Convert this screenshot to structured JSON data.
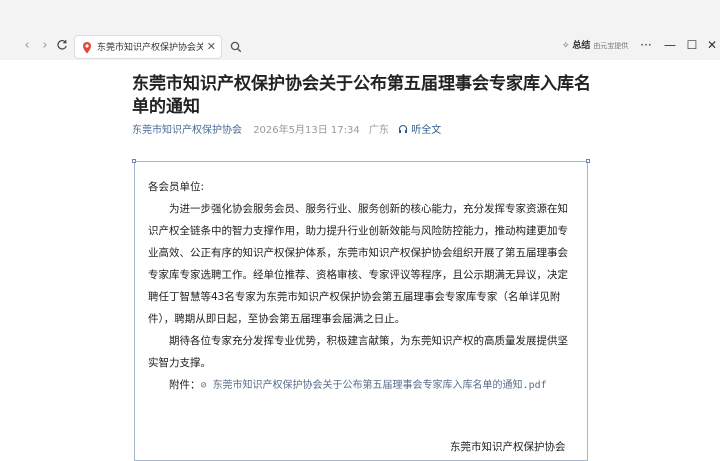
{
  "browser": {
    "tab_title": "东莞市知识产权保护协会关于",
    "tools_label": "总结",
    "tools_sub": "由元宝提供",
    "more_label": "···",
    "minimize": "—",
    "maximize": "☐",
    "close": "✕"
  },
  "article": {
    "title": "东莞市知识产权保护协会关于公布第五届理事会专家库入库名单的通知",
    "org": "东莞市知识产权保护协会",
    "date": "2026年5月13日 17:34",
    "region": "广东",
    "listen": "听全文"
  },
  "document": {
    "salutation": "各会员单位:",
    "para1": "为进一步强化协会服务会员、服务行业、服务创新的核心能力，充分发挥专家资源在知识产权全链条中的智力支撑作用，助力提升行业创新效能与风险防控能力，推动构建更加专业高效、公正有序的知识产权保护体系，东莞市知识产权保护协会组织开展了第五届理事会专家库专家选聘工作。经单位推荐、资格审核、专家评议等程序，且公示期满无异议，决定聘任丁智慧等43名专家为东莞市知识产权保护协会第五届理事会专家库专家（名单详见附件），聘期从即日起，至协会第五届理事会届满之日止。",
    "para2": "期待各位专家充分发挥专业优势，积极建言献策，为东莞知识产权的高质量发展提供坚实智力支撑。",
    "attach_label": "附件：",
    "attach_link": "东莞市知识产权保护协会关于公布第五届理事会专家库入库名单的通知.pdf",
    "signature": "东莞市知识产权保护协会"
  }
}
